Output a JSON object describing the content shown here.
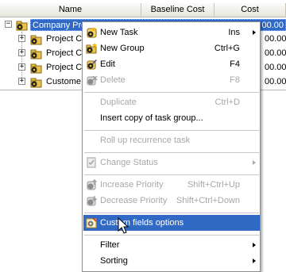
{
  "columns": {
    "name": "Name",
    "baseline_cost": "Baseline Cost",
    "cost": "Cost"
  },
  "tree": {
    "root": {
      "label": "Company Pro",
      "expander": "−",
      "value": "00.00"
    },
    "children": [
      {
        "label": "Project C",
        "expander": "+"
      },
      {
        "label": "Project C",
        "expander": "+"
      },
      {
        "label": "Project C",
        "expander": "+"
      },
      {
        "label": "Custome",
        "expander": "+"
      }
    ]
  },
  "tree_tail_values": [
    "00.00",
    "00.00",
    "00.00",
    "00.00"
  ],
  "menu": {
    "new_task": {
      "label": "New Task",
      "shortcut": "Ins"
    },
    "new_group": {
      "label": "New Group",
      "shortcut": "Ctrl+G"
    },
    "edit": {
      "label": "Edit",
      "shortcut": "F4"
    },
    "delete": {
      "label": "Delete",
      "shortcut": "F8"
    },
    "duplicate": {
      "label": "Duplicate",
      "shortcut": "Ctrl+D"
    },
    "insert_copy": {
      "label": "Insert copy of task group..."
    },
    "roll_up": {
      "label": "Roll up recurrence task"
    },
    "change_status": {
      "label": "Change Status"
    },
    "increase_priority": {
      "label": "Increase Priority",
      "shortcut": "Shift+Ctrl+Up"
    },
    "decrease_priority": {
      "label": "Decrease Priority",
      "shortcut": "Shift+Ctrl+Down"
    },
    "custom_fields": {
      "label": "Custom fields options"
    },
    "filter": {
      "label": "Filter"
    },
    "sorting": {
      "label": "Sorting"
    }
  },
  "colors": {
    "selection": "#316ac5",
    "disabled_text": "#a7a7a7"
  }
}
